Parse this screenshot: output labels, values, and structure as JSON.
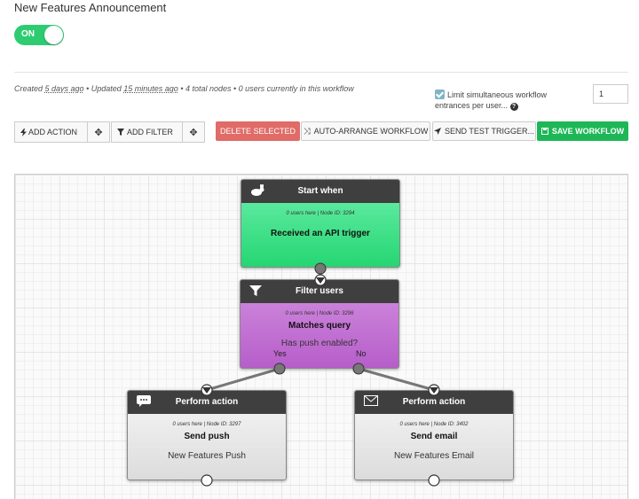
{
  "header": {
    "title": "New Features Announcement",
    "toggle_label": "ON"
  },
  "meta": {
    "created_prefix": "Created ",
    "created_value": "5 days ago",
    "updated_prefix": " • Updated ",
    "updated_value": "15 minutes ago",
    "rest": " • 4 total nodes • 0 users currently in this workflow"
  },
  "limit": {
    "label": "Limit simultaneous workflow entrances per user...",
    "checked": true,
    "value": "1"
  },
  "toolbar": {
    "add_action": "ADD ACTION",
    "add_filter": "ADD FILTER",
    "delete_selected": "DELETE SELECTED",
    "auto_arrange": "AUTO-ARRANGE WORKFLOW",
    "send_test": "SEND TEST TRIGGER...",
    "save": "SAVE WORKFLOW"
  },
  "nodes": {
    "start": {
      "header": "Start when",
      "sub": "0 users here | Node ID: 3294",
      "name": "Received an API trigger",
      "icon": "rabbit-icon"
    },
    "filter": {
      "header": "Filter users",
      "sub": "0 users here | Node ID: 3296",
      "name": "Matches query",
      "detail": "Has push enabled?",
      "yes": "Yes",
      "no": "No",
      "icon": "funnel-icon"
    },
    "push": {
      "header": "Perform action",
      "sub": "0 users here | Node ID: 3297",
      "name": "Send push",
      "detail": "New Features Push",
      "icon": "speech-bubble-icon"
    },
    "email": {
      "header": "Perform action",
      "sub": "0 users here | Node ID: 3402",
      "name": "Send email",
      "detail": "New Features Email",
      "icon": "envelope-icon"
    }
  },
  "colors": {
    "toggle_on": "#2ecc71",
    "delete": "#e06b67",
    "save": "#1eb757",
    "start_node": "#25d672",
    "filter_node": "#b65ec9",
    "action_node": "#dcdcdc"
  }
}
